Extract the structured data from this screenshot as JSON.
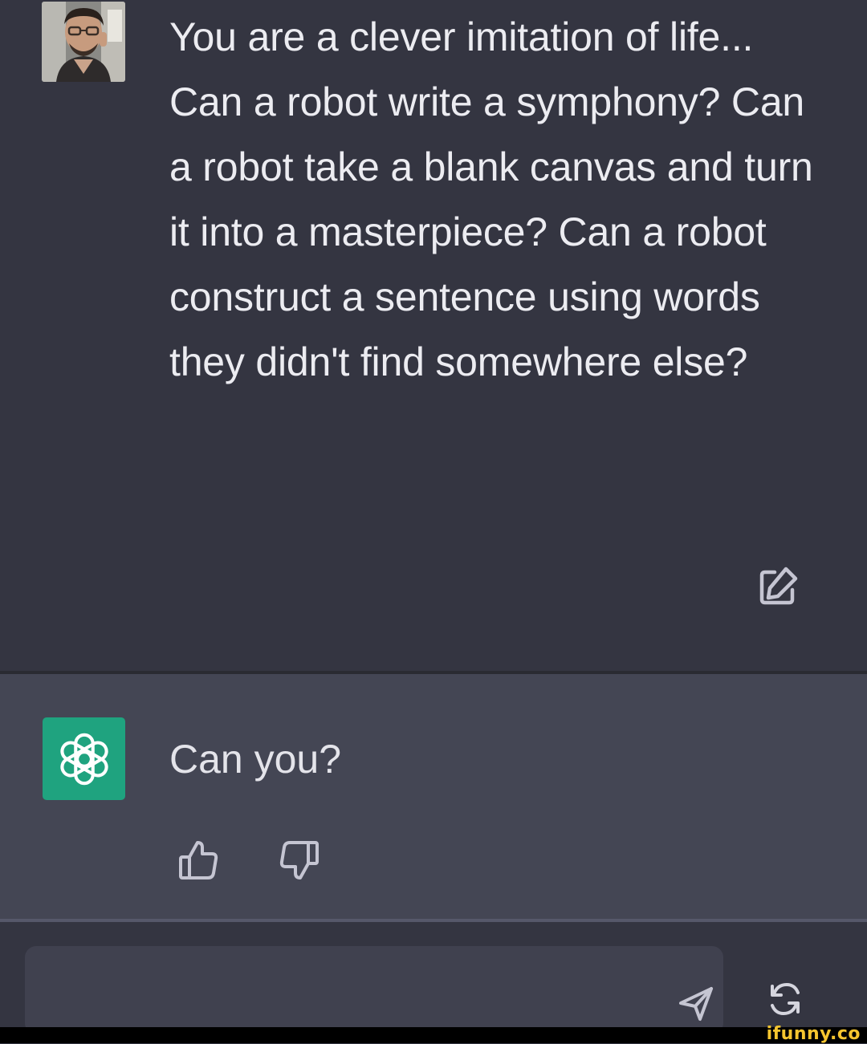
{
  "user_message": {
    "text": "You are a clever imitation of life... Can a robot write a symphony? Can a robot take a blank canvas and turn it into a masterpiece? Can a robot construct a sentence using words they didn't find somewhere else?",
    "avatar_icon": "user-photo",
    "edit_icon": "edit-icon"
  },
  "assistant_message": {
    "text": "Can you?",
    "avatar_icon": "openai-logo",
    "avatar_color": "#1fa37f",
    "thumbs_up_icon": "thumbs-up-icon",
    "thumbs_down_icon": "thumbs-down-icon"
  },
  "composer": {
    "input_value": "",
    "send_icon": "send-icon",
    "regenerate_icon": "regenerate-icon"
  },
  "watermark": {
    "text": "ifunny.co"
  },
  "colors": {
    "background": "#343541",
    "assistant_background": "#444654",
    "input_background": "#40414f",
    "text": "#ececf1",
    "watermark": "#f6c52f"
  }
}
